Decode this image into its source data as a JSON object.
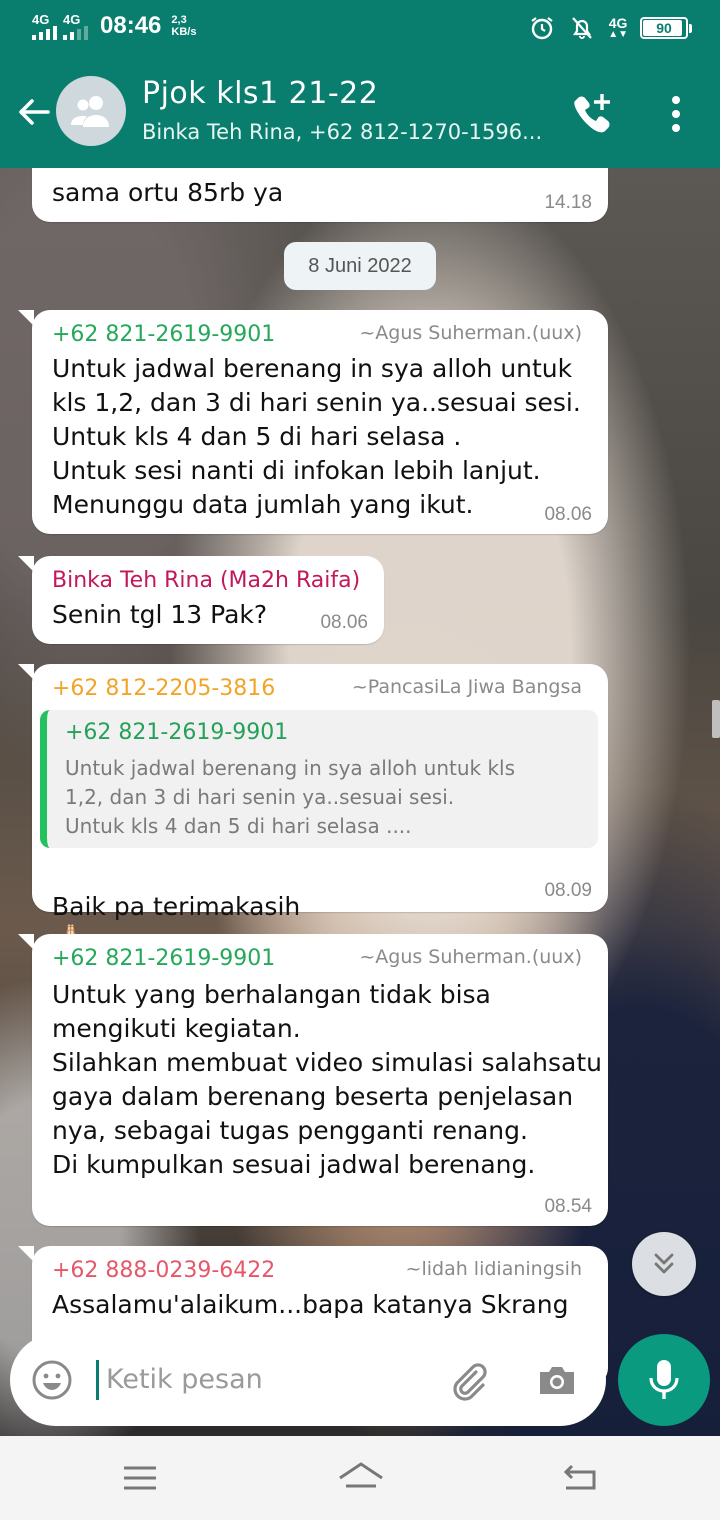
{
  "status_bar": {
    "sim1_label": "4G",
    "sim2_label": "4G",
    "time": "08:46",
    "net_speed_value": "2,3",
    "net_speed_unit": "KB/s",
    "lte_label": "4G",
    "battery": "90"
  },
  "header": {
    "title": "Pjok kls1 21-22",
    "subtitle": "Binka Teh Rina, +62 812-1270-1596..."
  },
  "date_chip": "8 Juni 2022",
  "messages": [
    {
      "text": "sama ortu 85rb ya",
      "time": "14.18"
    },
    {
      "sender": "+62 821-2619-9901",
      "sender_color": "#25a85a",
      "alias": "~Agus Suherman.(uux)",
      "text": "Untuk jadwal berenang in sya alloh untuk\nkls 1,2, dan 3 di hari senin ya..sesuai sesi.\nUntuk kls 4 dan 5 di hari selasa .\nUntuk sesi nanti di infokan lebih lanjut.\nMenunggu data jumlah yang ikut.",
      "time": "08.06"
    },
    {
      "sender": "Binka Teh Rina (Ma2h Raifa)",
      "sender_color": "#c2185b",
      "text": "Senin tgl 13 Pak?",
      "time": "08.06"
    },
    {
      "sender": "+62 812-2205-3816",
      "sender_color": "#f0a52a",
      "alias": "~PancasiLa Jiwa Bangsa",
      "quote_sender": "+62 821-2619-9901",
      "quote_text": "Untuk jadwal berenang in sya alloh untuk kls\n1,2, dan 3 di hari senin ya..sesuai sesi.\nUntuk kls 4 dan 5 di hari selasa ....",
      "text": "Baik pa terimakasih",
      "emoji": "🙏🏻",
      "time": "08.09"
    },
    {
      "sender": "+62 821-2619-9901",
      "sender_color": "#25a85a",
      "alias": "~Agus Suherman.(uux)",
      "text": "Untuk yang berhalangan tidak bisa\nmengikuti kegiatan.\nSilahkan membuat video simulasi salahsatu\ngaya dalam berenang beserta penjelasan\nnya, sebagai tugas pengganti renang.\nDi kumpulkan sesuai jadwal berenang.",
      "time": "08.54"
    },
    {
      "sender": "+62 888-0239-6422",
      "sender_color": "#e5586a",
      "alias": "~lidah lidianingsih",
      "text": "Assalamu'alaikum...bapa katanya Skrang"
    }
  ],
  "composer": {
    "placeholder": "Ketik pesan"
  },
  "icons": {
    "back": "arrow-left",
    "avatar": "group-avatar",
    "call": "add-call",
    "menu": "more-vert",
    "emoji": "smiley",
    "attach": "paperclip",
    "camera": "camera",
    "mic": "microphone",
    "scroll": "chevron-double-down",
    "nav_menu": "hamburger",
    "nav_home": "home",
    "nav_back": "back"
  },
  "colors": {
    "header": "#0a7e6e",
    "accent": "#0a9a80"
  }
}
